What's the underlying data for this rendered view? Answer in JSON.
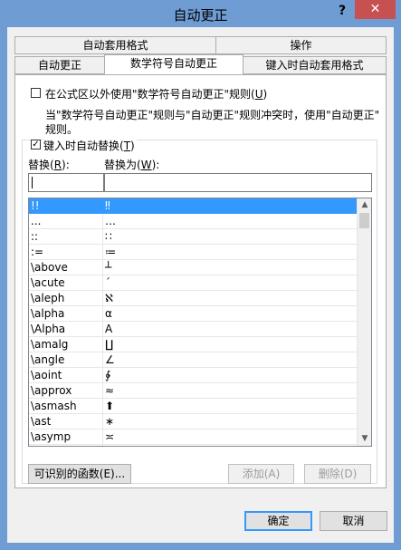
{
  "window": {
    "title": "自动更正",
    "help": "?",
    "close": "✕"
  },
  "tabs": {
    "back": [
      "自动套用格式",
      "操作"
    ],
    "front": [
      "自动更正",
      "数学符号自动更正",
      "键入时自动套用格式"
    ]
  },
  "options": {
    "outside_label_pre": "在公式区以外使用\"数学符号自动更正\"规则(",
    "outside_key": "U",
    "outside_label_post": ")",
    "note_line1": "当\"数学符号自动更正\"规则与\"自动更正\"规则冲突时，使用\"自动更正\"",
    "note_line2": "规则。",
    "replace_as_type_pre": "键入时自动替换(",
    "replace_as_type_key": "T",
    "replace_as_type_post": ")",
    "replace_label_pre": "替换(",
    "replace_key": "R",
    "replace_label_post": "):",
    "with_label_pre": "替换为(",
    "with_key": "W",
    "with_label_post": "):",
    "replace_value": "",
    "with_value": ""
  },
  "list": [
    {
      "replace": "!!",
      "with": "‼"
    },
    {
      "replace": "...",
      "with": "…"
    },
    {
      "replace": "::",
      "with": "∷"
    },
    {
      "replace": ":=",
      "with": "≔"
    },
    {
      "replace": "\\above",
      "with": "┴"
    },
    {
      "replace": "\\acute",
      "with": "´"
    },
    {
      "replace": "\\aleph",
      "with": "ℵ"
    },
    {
      "replace": "\\alpha",
      "with": "α"
    },
    {
      "replace": "\\Alpha",
      "with": "A"
    },
    {
      "replace": "\\amalg",
      "with": "∐"
    },
    {
      "replace": "\\angle",
      "with": "∠"
    },
    {
      "replace": "\\aoint",
      "with": "∳"
    },
    {
      "replace": "\\approx",
      "with": "≈"
    },
    {
      "replace": "\\asmash",
      "with": "⬆"
    },
    {
      "replace": "\\ast",
      "with": "∗"
    },
    {
      "replace": "\\asymp",
      "with": "≍"
    }
  ],
  "buttons": {
    "functions": "可识别的函数(E)...",
    "add": "添加(A)",
    "delete": "删除(D)",
    "ok": "确定",
    "cancel": "取消"
  },
  "colors": {
    "titlebar": "#6f9cd3",
    "close": "#c75050",
    "selection": "#3399ff"
  },
  "icons": {
    "scroll_up": "▲",
    "scroll_down": "▼",
    "check": "✓"
  }
}
